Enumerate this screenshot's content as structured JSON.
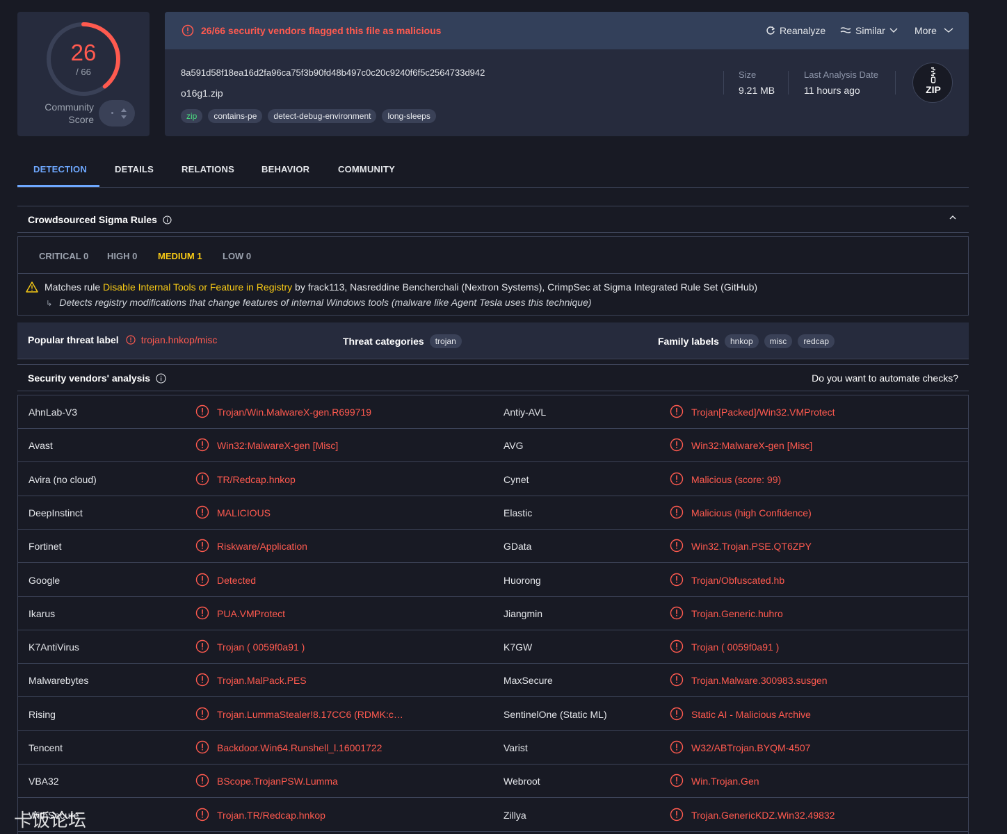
{
  "score": {
    "detections": "26",
    "total": "/ 66",
    "community_label": "Community\nScore"
  },
  "header": {
    "alert": "26/66 security vendors flagged this file as malicious",
    "reanalyze": "Reanalyze",
    "similar": "Similar",
    "more": "More",
    "hash": "8a591d58f18ea16d2fa96ca75f3b90fd48b497c0c20c9240f6f5c2564733d942",
    "filename": "o16g1.zip",
    "tags": [
      "zip",
      "contains-pe",
      "detect-debug-environment",
      "long-sleeps"
    ],
    "size_label": "Size",
    "size_value": "9.21 MB",
    "date_label": "Last Analysis Date",
    "date_value": "11 hours ago",
    "filetype": "ZIP"
  },
  "tabs": [
    "DETECTION",
    "DETAILS",
    "RELATIONS",
    "BEHAVIOR",
    "COMMUNITY"
  ],
  "sigma": {
    "title": "Crowdsourced Sigma Rules",
    "severities": [
      "CRITICAL 0",
      "HIGH 0",
      "MEDIUM 1",
      "LOW 0"
    ],
    "rule_prefix": "Matches rule ",
    "rule_name": "Disable Internal Tools or Feature in Registry",
    "rule_suffix": " by frack113, Nasreddine Bencherchali (Nextron Systems), CrimpSec at Sigma Integrated Rule Set (GitHub)",
    "rule_desc": "Detects registry modifications that change features of internal Windows tools (malware like Agent Tesla uses this technique)"
  },
  "threat": {
    "popular_label": "Popular threat label",
    "popular_value": "trojan.hnkop/misc",
    "categories_label": "Threat categories",
    "categories": [
      "trojan"
    ],
    "family_label": "Family labels",
    "families": [
      "hnkop",
      "misc",
      "redcap"
    ]
  },
  "vendors": {
    "title": "Security vendors' analysis",
    "automate": "Do you want to automate checks?",
    "rows": [
      [
        [
          "AhnLab-V3",
          "Trojan/Win.MalwareX-gen.R699719"
        ],
        [
          "Antiy-AVL",
          "Trojan[Packed]/Win32.VMProtect"
        ]
      ],
      [
        [
          "Avast",
          "Win32:MalwareX-gen [Misc]"
        ],
        [
          "AVG",
          "Win32:MalwareX-gen [Misc]"
        ]
      ],
      [
        [
          "Avira (no cloud)",
          "TR/Redcap.hnkop"
        ],
        [
          "Cynet",
          "Malicious (score: 99)"
        ]
      ],
      [
        [
          "DeepInstinct",
          "MALICIOUS"
        ],
        [
          "Elastic",
          "Malicious (high Confidence)"
        ]
      ],
      [
        [
          "Fortinet",
          "Riskware/Application"
        ],
        [
          "GData",
          "Win32.Trojan.PSE.QT6ZPY"
        ]
      ],
      [
        [
          "Google",
          "Detected"
        ],
        [
          "Huorong",
          "Trojan/Obfuscated.hb"
        ]
      ],
      [
        [
          "Ikarus",
          "PUA.VMProtect"
        ],
        [
          "Jiangmin",
          "Trojan.Generic.huhro"
        ]
      ],
      [
        [
          "K7AntiVirus",
          "Trojan ( 0059f0a91 )"
        ],
        [
          "K7GW",
          "Trojan ( 0059f0a91 )"
        ]
      ],
      [
        [
          "Malwarebytes",
          "Trojan.MalPack.PES"
        ],
        [
          "MaxSecure",
          "Trojan.Malware.300983.susgen"
        ]
      ],
      [
        [
          "Rising",
          "Trojan.LummaStealer!8.17CC6 (RDMK:c…"
        ],
        [
          "SentinelOne (Static ML)",
          "Static AI - Malicious Archive"
        ]
      ],
      [
        [
          "Tencent",
          "Backdoor.Win64.Runshell_l.16001722"
        ],
        [
          "Varist",
          "W32/ABTrojan.BYQM-4507"
        ]
      ],
      [
        [
          "VBA32",
          "BScope.TrojanPSW.Lumma"
        ],
        [
          "Webroot",
          "Win.Trojan.Gen"
        ]
      ],
      [
        [
          "WithSecure",
          "Trojan.TR/Redcap.hnkop"
        ],
        [
          "Zillya",
          "Trojan.GenericKDZ.Win32.49832"
        ]
      ]
    ]
  },
  "watermark": "卡饭论坛"
}
